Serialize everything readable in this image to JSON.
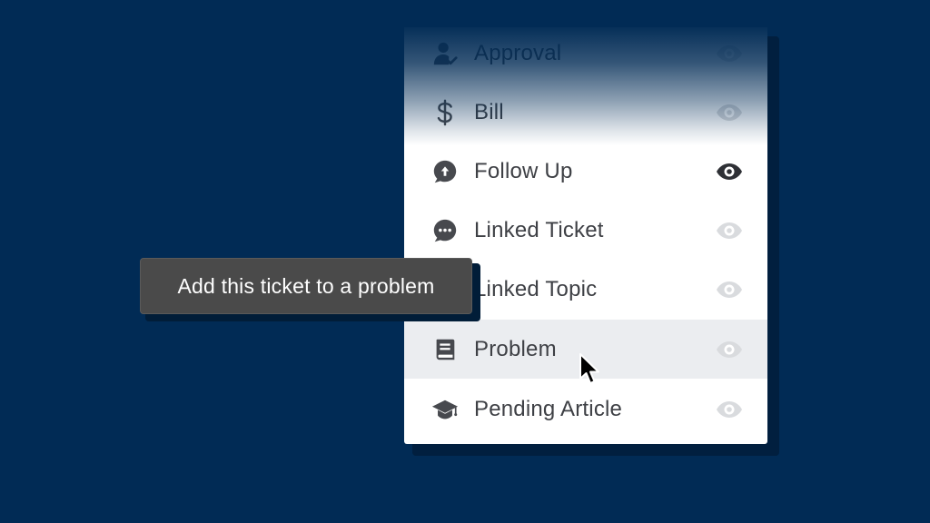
{
  "menu": {
    "items": [
      {
        "label": "Approval",
        "icon": "person-check-icon",
        "visible": false
      },
      {
        "label": "Bill",
        "icon": "dollar-icon",
        "visible": false
      },
      {
        "label": "Follow Up",
        "icon": "follow-up-bubble-icon",
        "visible": true
      },
      {
        "label": "Linked Ticket",
        "icon": "chat-dots-icon",
        "visible": false
      },
      {
        "label": "Linked Topic",
        "icon": "topic-icon",
        "visible": false
      },
      {
        "label": "Problem",
        "icon": "book-icon",
        "visible": false,
        "hovered": true
      },
      {
        "label": "Pending Article",
        "icon": "graduation-cap-icon",
        "visible": false
      }
    ]
  },
  "tooltip": {
    "text": "Add this ticket to a problem"
  },
  "colors": {
    "background": "#012b55",
    "panel": "#ffffff",
    "hover_row": "#ebedf0",
    "text": "#3e4045",
    "eye_on": "#2e3035",
    "eye_off": "#d9dbde",
    "tooltip_bg": "#4a4a4a"
  }
}
